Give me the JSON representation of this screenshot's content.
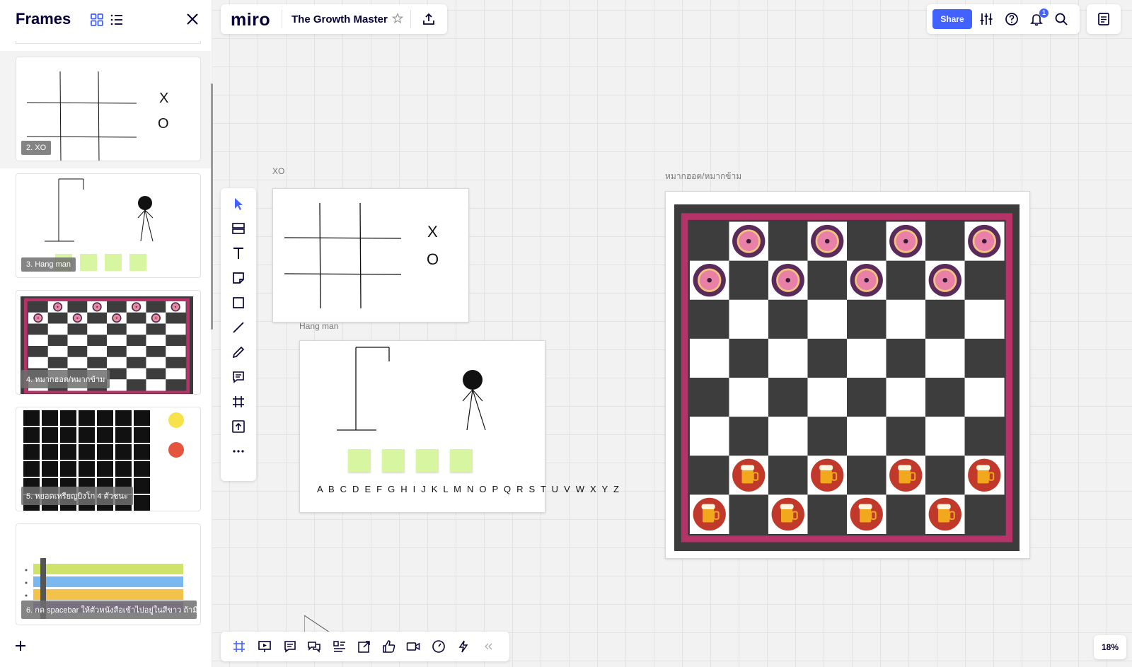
{
  "sidebar": {
    "title": "Frames",
    "frames": [
      {
        "label": "2. XO"
      },
      {
        "label": "3. Hang man"
      },
      {
        "label": "4. หมากฮอต/หมากข้าม"
      },
      {
        "label": "5. หยอดเหรียญบิงโก 4 ตัวชนะ"
      },
      {
        "label": "6. กด spacebar ให้ตัวหนังสือเข้าไปอยู่ในสีขาว ถ้ามี"
      }
    ],
    "icons": [
      "grid-view-icon",
      "list-view-icon",
      "close-icon",
      "plus-icon"
    ]
  },
  "topbar": {
    "logo": "miro",
    "board_name": "The Growth Master"
  },
  "rightbar": {
    "share_label": "Share",
    "notification_count": "1"
  },
  "canvas": {
    "xo": {
      "frame_label": "XO",
      "x_mark": "X",
      "o_mark": "O"
    },
    "hangman": {
      "frame_label": "Hang man",
      "alphabet": "A B C D E F G H I J K L M N O P Q R S T U V W X Y Z"
    },
    "checkers": {
      "frame_label": "หมากฮอต/หมากข้าม"
    }
  },
  "zoom": "18%",
  "colors": {
    "accent": "#4262ff",
    "board_border": "#b6336a",
    "board_dark": "#3c3c3c",
    "donut": "#5a2a5a",
    "beer": "#c0392b"
  }
}
